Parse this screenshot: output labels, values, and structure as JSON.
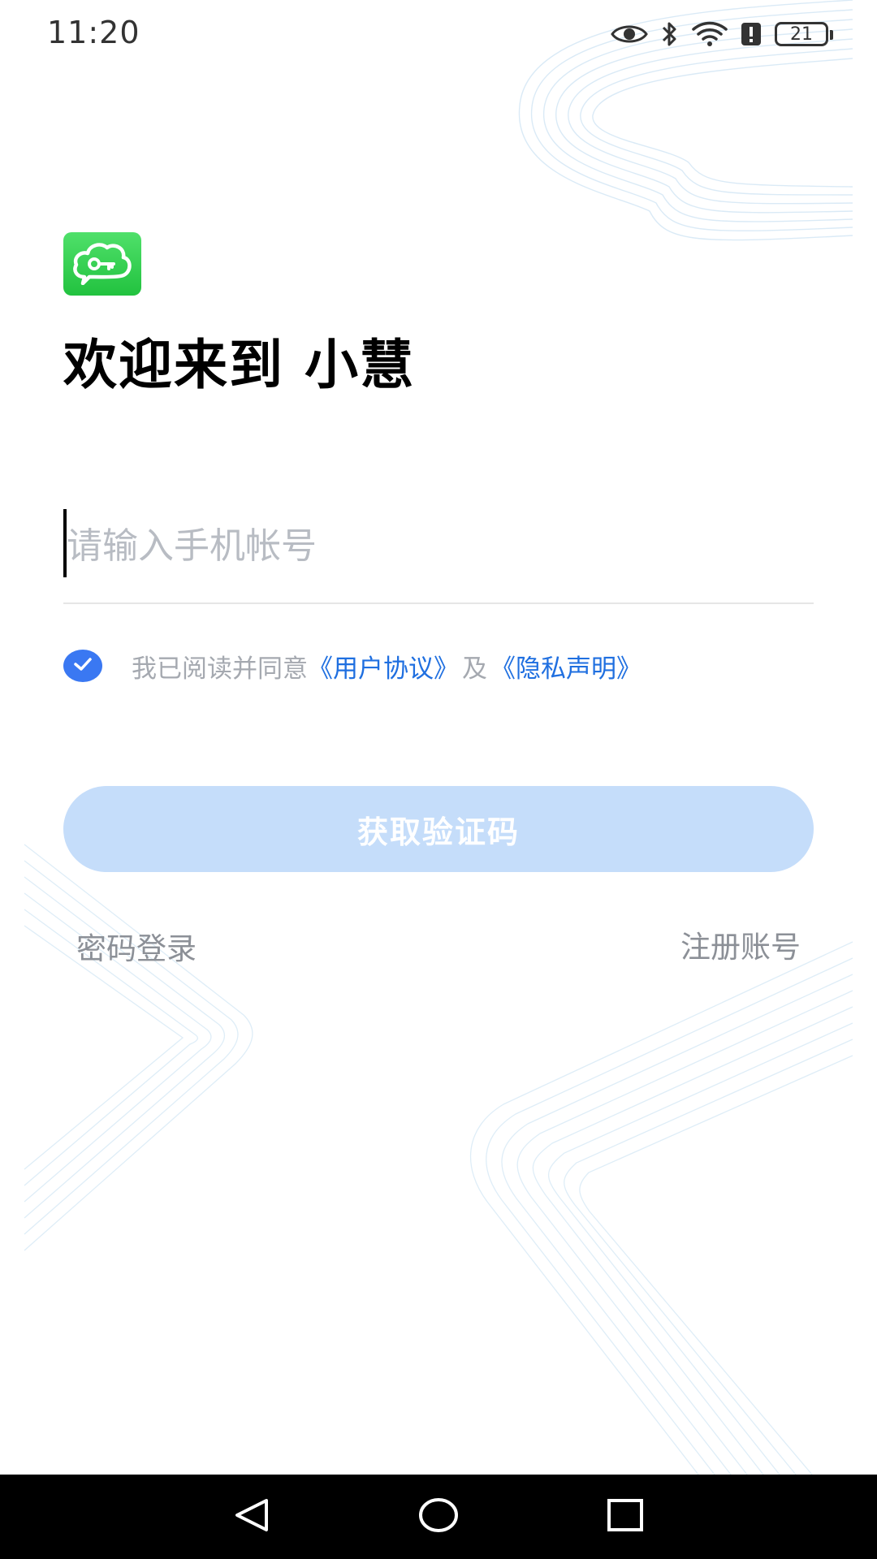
{
  "status_bar": {
    "time": "11:20",
    "battery_level": "21",
    "icons": [
      "eye-icon",
      "bluetooth-icon",
      "wifi-icon",
      "alert-icon",
      "battery-icon"
    ]
  },
  "app": {
    "logo_icon": "cloud-key-icon",
    "welcome_title": "欢迎来到 小慧"
  },
  "login_form": {
    "phone_placeholder": "请输入手机帐号",
    "phone_value": "",
    "agreement": {
      "checked": true,
      "prefix": "我已阅读并同意",
      "user_agreement_label": "《用户协议》",
      "conjunction": "及",
      "privacy_label": "《隐私声明》"
    },
    "get_code_label": "获取验证码",
    "password_login_label": "密码登录",
    "register_label": "注册账号"
  },
  "nav_bar": {
    "buttons": [
      "back-icon",
      "home-icon",
      "recents-icon"
    ]
  },
  "colors": {
    "accent": "#3a78f2",
    "link": "#1f6fe0",
    "button_disabled": "#c5ddfa",
    "logo_green": "#2fcf4b"
  }
}
